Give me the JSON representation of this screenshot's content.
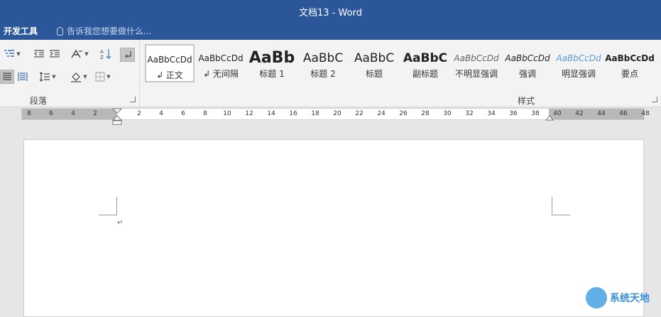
{
  "window": {
    "title": "文档13 - Word"
  },
  "menubar": {
    "dev_tab": "开发工具",
    "tell_me": "告诉我您想要做什么..."
  },
  "paragraph_group": {
    "label": "段落"
  },
  "styles_group": {
    "label": "样式",
    "items": [
      {
        "sample": "AaBbCcDd",
        "name": "↲ 正文"
      },
      {
        "sample": "AaBbCcDd",
        "name": "↲ 无间隔"
      },
      {
        "sample": "AaBb",
        "name": "标题 1"
      },
      {
        "sample": "AaBbC",
        "name": "标题 2"
      },
      {
        "sample": "AaBbC",
        "name": "标题"
      },
      {
        "sample": "AaBbC",
        "name": "副标题"
      },
      {
        "sample": "AaBbCcDd",
        "name": "不明显强调"
      },
      {
        "sample": "AaBbCcDd",
        "name": "强调"
      },
      {
        "sample": "AaBbCcDd",
        "name": "明显强调"
      },
      {
        "sample": "AaBbCcDd",
        "name": "要点"
      }
    ]
  },
  "ruler": {
    "left_labels": [
      "8",
      "6",
      "4",
      "2"
    ],
    "right_labels": [
      "2",
      "4",
      "6",
      "8",
      "10",
      "12",
      "14",
      "16",
      "18",
      "20",
      "22",
      "24",
      "26",
      "28",
      "30",
      "32",
      "34",
      "36",
      "38",
      "40",
      "42",
      "44",
      "46",
      "48"
    ]
  },
  "document": {
    "paragraph_mark": "↵"
  },
  "watermark": {
    "text": "系统天地"
  },
  "colors": {
    "brand": "#2b579a",
    "ribbon_bg": "#f3f3f3",
    "canvas": "#e6e6e6"
  }
}
